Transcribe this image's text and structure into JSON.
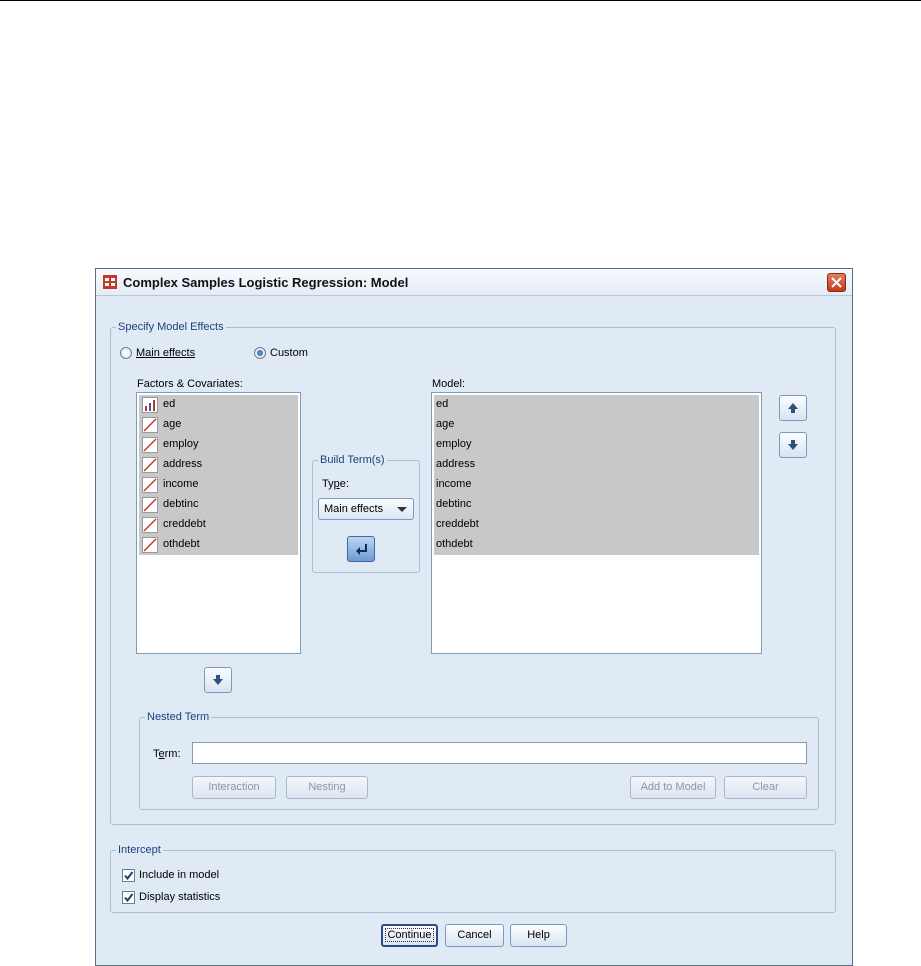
{
  "window": {
    "title": "Complex Samples Logistic Regression: Model"
  },
  "specify": {
    "legend": "Specify Model Effects",
    "main_effects_label": "Main effects",
    "custom_label": "Custom",
    "factors_label": "Factors & Covariates:",
    "model_label": "Model:",
    "factors": [
      {
        "name": "ed",
        "icon": "ordinal-icon"
      },
      {
        "name": "age",
        "icon": "scale-icon"
      },
      {
        "name": "employ",
        "icon": "scale-icon"
      },
      {
        "name": "address",
        "icon": "scale-icon"
      },
      {
        "name": "income",
        "icon": "scale-icon"
      },
      {
        "name": "debtinc",
        "icon": "scale-icon"
      },
      {
        "name": "creddebt",
        "icon": "scale-icon"
      },
      {
        "name": "othdebt",
        "icon": "scale-icon"
      }
    ],
    "model": [
      "ed",
      "age",
      "employ",
      "address",
      "income",
      "debtinc",
      "creddebt",
      "othdebt"
    ]
  },
  "build": {
    "legend": "Build Term(s)",
    "type_label": "Type:",
    "type_value": "Main effects"
  },
  "nested": {
    "legend": "Nested Term",
    "term_label": "Term:",
    "term_value": "",
    "interaction": "Interaction",
    "nesting": "Nesting",
    "add_to_model": "Add to Model",
    "clear": "Clear"
  },
  "intercept": {
    "legend": "Intercept",
    "include": "Include in model",
    "include_checked": true,
    "display": "Display statistics",
    "display_checked": true
  },
  "footer": {
    "continue": "Continue",
    "cancel": "Cancel",
    "help": "Help"
  },
  "colors": {
    "dialog_bg": "#dfeaf5",
    "selection": "#c8c8c8",
    "legend_text": "#1f3e7a"
  }
}
